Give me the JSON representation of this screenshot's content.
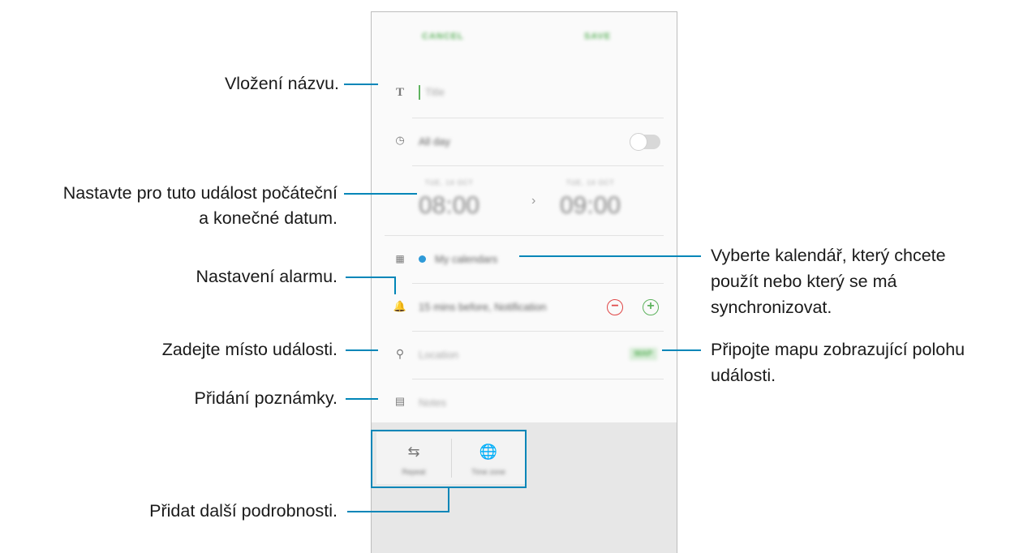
{
  "phone": {
    "header": {
      "cancel_label": "CANCEL",
      "save_label": "SAVE"
    },
    "title_field": {
      "placeholder": "Title",
      "icon": "title-t-icon"
    },
    "all_day": {
      "label": "All day",
      "toggle_on": false,
      "icon": "clock-icon"
    },
    "start": {
      "date": "TUE, 14 OCT",
      "time": "08:00"
    },
    "end": {
      "date": "TUE, 14 OCT",
      "time": "09:00"
    },
    "arrow": "›",
    "calendar": {
      "label": "My calendars",
      "dot_color": "#2f9ad8",
      "icon": "calendar-icon"
    },
    "reminder": {
      "label": "15 mins before, Notification",
      "icon": "bell-icon",
      "minus": "−",
      "plus": "+"
    },
    "location": {
      "placeholder": "Location",
      "map_label": "MAP",
      "icon": "pin-icon"
    },
    "notes": {
      "placeholder": "Notes",
      "icon": "notes-icon"
    },
    "bottom": {
      "repeat_label": "Repeat",
      "timezone_label": "Time zone"
    }
  },
  "callouts": {
    "title": "Vložení názvu.",
    "dates_1": "Nastavte pro tuto událost počáteční",
    "dates_2": "a konečné datum.",
    "alarm": "Nastavení alarmu.",
    "location": "Zadejte místo události.",
    "notes": "Přidání poznámky.",
    "more": "Přidat další podrobnosti.",
    "calendar_1": "Vyberte kalendář, který chcete",
    "calendar_2": "použít nebo který se má",
    "calendar_3": "synchronizovat.",
    "map_1": "Připojte mapu zobrazující polohu",
    "map_2": "události."
  },
  "colors": {
    "accent": "#0086b8",
    "green": "#5fb35f",
    "red": "#e04848"
  }
}
